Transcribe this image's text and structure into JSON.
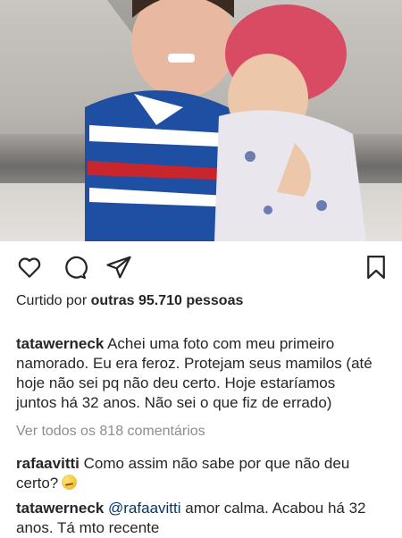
{
  "post": {
    "icons": {
      "like": "heart-icon",
      "comment": "comment-icon",
      "share": "send-icon",
      "save": "bookmark-icon"
    },
    "likes": {
      "prefix": "Curtido por ",
      "others": "outras 95.710 pessoas"
    },
    "caption": {
      "username": "tatawerneck",
      "text": "Achei uma foto com meu primeiro namorado. Eu era feroz. Protejam seus mamilos (até hoje não sei pq não deu certo. Hoje estaríamos juntos há 32 anos. Não sei o que fiz de errado)"
    },
    "view_all_comments": "Ver todos os 818 comentários",
    "comments": [
      {
        "username": "rafaavitti",
        "text": "Como assim não sabe por que não deu certo?",
        "emoji": "thinking-face-emoji"
      },
      {
        "username": "tatawerneck",
        "mention": "@rafaavitti",
        "text": "amor calma. Acabou há 32 anos. Tá mto recente"
      }
    ]
  }
}
